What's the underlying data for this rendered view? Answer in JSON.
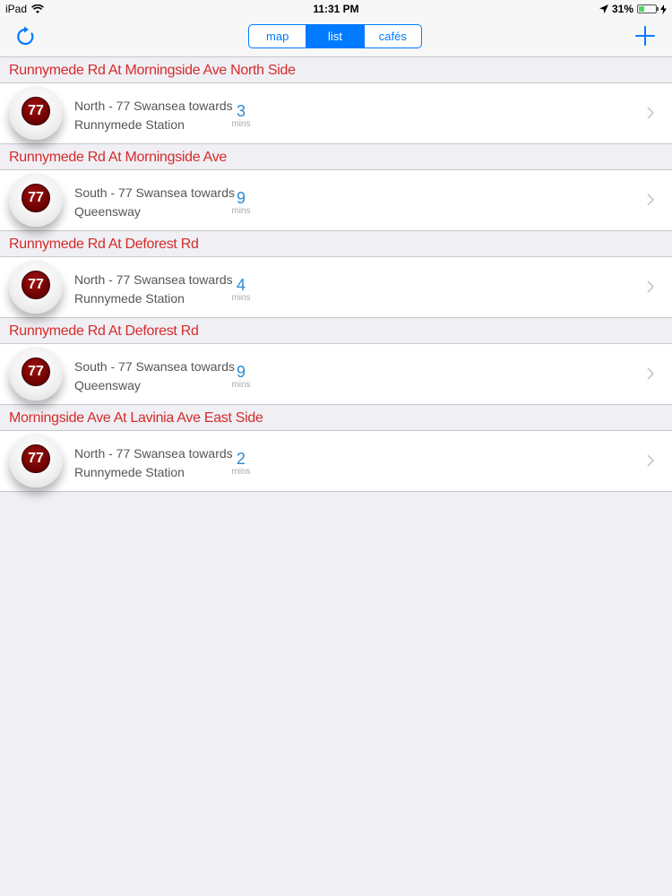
{
  "status_bar": {
    "device": "iPad",
    "time": "11:31 PM",
    "battery": "31%",
    "battery_level": 0.31
  },
  "nav": {
    "tabs": [
      {
        "label": "map",
        "selected": false
      },
      {
        "label": "list",
        "selected": true
      },
      {
        "label": "cafés",
        "selected": false
      }
    ]
  },
  "stops": [
    {
      "name": "Runnymede Rd At Morningside Ave North Side",
      "route": "77",
      "direction": "North - 77 Swansea towards",
      "destination": "Runnymede Station",
      "eta": "3",
      "eta_unit": "mins"
    },
    {
      "name": "Runnymede Rd At Morningside Ave",
      "route": "77",
      "direction": "South - 77 Swansea towards",
      "destination": "Queensway",
      "eta": "9",
      "eta_unit": "mins"
    },
    {
      "name": "Runnymede Rd At Deforest Rd",
      "route": "77",
      "direction": "North - 77 Swansea towards",
      "destination": "Runnymede Station",
      "eta": "4",
      "eta_unit": "mins"
    },
    {
      "name": "Runnymede Rd At Deforest Rd",
      "route": "77",
      "direction": "South - 77 Swansea towards",
      "destination": "Queensway",
      "eta": "9",
      "eta_unit": "mins"
    },
    {
      "name": "Morningside Ave At Lavinia Ave East Side",
      "route": "77",
      "direction": "North - 77 Swansea towards",
      "destination": "Runnymede Station",
      "eta": "2",
      "eta_unit": "mins"
    }
  ],
  "colors": {
    "accent": "#007aff",
    "section_header": "#d62b2b",
    "eta": "#2a8ad4",
    "route_badge": "#6a0000"
  },
  "icons": [
    "refresh-icon",
    "add-icon",
    "wifi-icon",
    "location-arrow-icon",
    "battery-icon",
    "charging-icon",
    "chevron-right-icon"
  ]
}
